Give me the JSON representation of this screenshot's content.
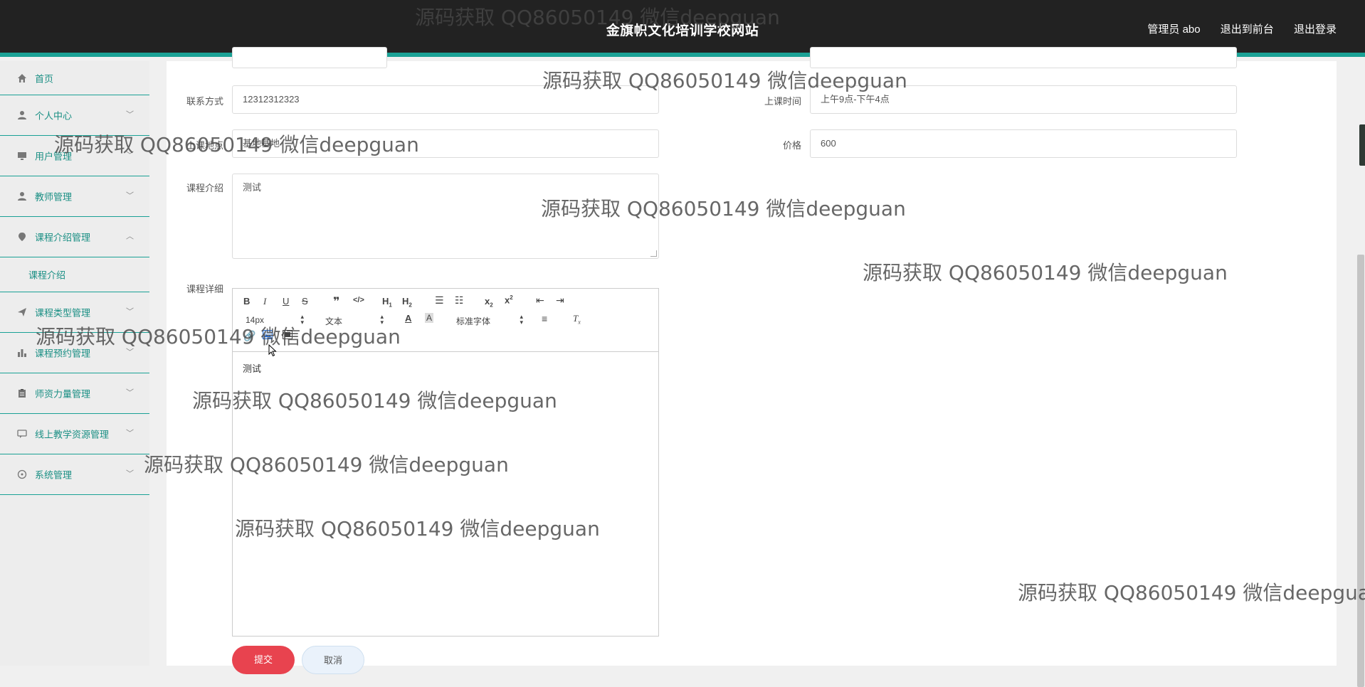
{
  "header": {
    "title": "金旗帜文化培训学校网站",
    "links": [
      "管理员 abo",
      "退出到前台",
      "退出登录"
    ]
  },
  "sidebar": {
    "items": [
      {
        "label": "首页",
        "icon": "home-icon",
        "expanded": false
      },
      {
        "label": "个人中心",
        "icon": "user-icon"
      },
      {
        "label": "用户管理",
        "icon": "monitor-icon"
      },
      {
        "label": "教师管理",
        "icon": "user-icon"
      },
      {
        "label": "课程介绍管理",
        "icon": "pin-icon",
        "expanded": true
      },
      {
        "label": "课程介绍",
        "sub": true
      },
      {
        "label": "课程类型管理",
        "icon": "send-icon"
      },
      {
        "label": "课程预约管理",
        "icon": "bar-chart-icon"
      },
      {
        "label": "师资力量管理",
        "icon": "clipboard-icon"
      },
      {
        "label": "线上教学资源管理",
        "icon": "chat-icon"
      },
      {
        "label": "系统管理",
        "icon": "compass-icon"
      }
    ]
  },
  "form": {
    "contact_label": "联系方式",
    "contact_value": "12312312323",
    "time_label": "上课时间",
    "time_value": "上午9点-下午4点",
    "location_label": "上课地点",
    "location_value": "基地基地",
    "price_label": "价格",
    "price_value": "600",
    "intro_label": "课程介绍",
    "intro_value": "测试",
    "detail_label": "课程详细",
    "detail_value": "测试",
    "submit": "提交",
    "cancel": "取消"
  },
  "editor": {
    "font_size": "14px",
    "header_select": "文本",
    "font_family": "标准字体"
  },
  "watermark": "源码获取 QQ86050149 微信deepguan",
  "colors": {
    "accent": "#1aa195",
    "header_bg": "#222222",
    "submit": "#e8434f"
  }
}
